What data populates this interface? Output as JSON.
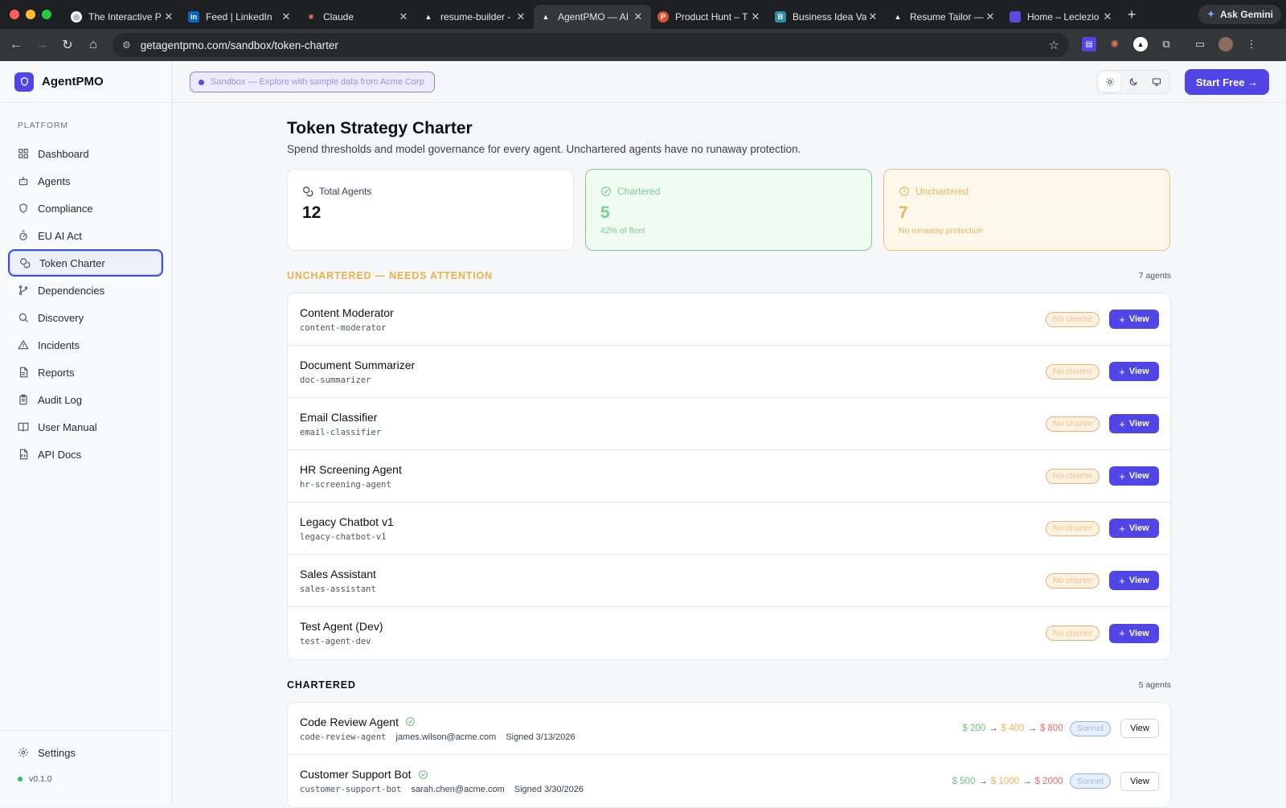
{
  "browser": {
    "tabs": [
      {
        "title": "The Interactive P",
        "favicon": "circle-logo",
        "color": "#ffffff",
        "active": false
      },
      {
        "title": "Feed | LinkedIn",
        "favicon": "linkedin",
        "color": "#0a66c2",
        "active": false
      },
      {
        "title": "Claude",
        "favicon": "claude-star",
        "color": "#d97757",
        "active": false
      },
      {
        "title": "resume-builder -",
        "favicon": "triangle",
        "color": "#ffffff",
        "active": false
      },
      {
        "title": "AgentPMO — AI",
        "favicon": "triangle",
        "color": "#ffffff",
        "active": true
      },
      {
        "title": "Product Hunt – T",
        "favicon": "producthunt",
        "color": "#da552f",
        "active": false
      },
      {
        "title": "Business Idea Va",
        "favicon": "b-square",
        "color": "#2f8fa6",
        "active": false
      },
      {
        "title": "Resume Tailor —",
        "favicon": "triangle",
        "color": "#ffffff",
        "active": false
      },
      {
        "title": "Home – Leclezio",
        "favicon": "purple-square",
        "color": "#5b4be0",
        "active": false
      }
    ],
    "url": "getagentpmo.com/sandbox/token-charter",
    "gemini_label": "Ask Gemini"
  },
  "app": {
    "brand": "AgentPMO",
    "sandbox_banner": "Sandbox — Explore with sample data from Acme Corp",
    "start_free": "Start Free →",
    "sidebar": {
      "section_label": "PLATFORM",
      "items": [
        {
          "label": "Dashboard",
          "icon": "grid-icon",
          "active": false
        },
        {
          "label": "Agents",
          "icon": "bot-icon",
          "active": false
        },
        {
          "label": "Compliance",
          "icon": "shield-icon",
          "active": false
        },
        {
          "label": "EU AI Act",
          "icon": "timer-icon",
          "active": false
        },
        {
          "label": "Token Charter",
          "icon": "coins-icon",
          "active": true
        },
        {
          "label": "Dependencies",
          "icon": "git-branch-icon",
          "active": false
        },
        {
          "label": "Discovery",
          "icon": "search-icon",
          "active": false
        },
        {
          "label": "Incidents",
          "icon": "alert-triangle-icon",
          "active": false
        },
        {
          "label": "Reports",
          "icon": "file-icon",
          "active": false
        },
        {
          "label": "Audit Log",
          "icon": "clipboard-icon",
          "active": false
        },
        {
          "label": "User Manual",
          "icon": "book-icon",
          "active": false
        },
        {
          "label": "API Docs",
          "icon": "file-code-icon",
          "active": false
        }
      ],
      "settings_label": "Settings",
      "version": "v0.1.0"
    },
    "page": {
      "title": "Token Strategy Charter",
      "subtitle": "Spend thresholds and model governance for every agent. Unchartered agents have no runaway protection.",
      "stats": {
        "total": {
          "label": "Total Agents",
          "value": "12"
        },
        "chartered": {
          "label": "Chartered",
          "value": "5",
          "sub": "42% of fleet"
        },
        "unchartered": {
          "label": "Unchartered",
          "value": "7",
          "sub": "No runaway protection"
        }
      },
      "unchartered_section": {
        "heading": "UNCHARTERED — NEEDS ATTENTION",
        "count": "7 agents",
        "badge": "No charter",
        "view": "View",
        "agents": [
          {
            "name": "Content Moderator",
            "id": "content-moderator"
          },
          {
            "name": "Document Summarizer",
            "id": "doc-summarizer"
          },
          {
            "name": "Email Classifier",
            "id": "email-classifier"
          },
          {
            "name": "HR Screening Agent",
            "id": "hr-screening-agent"
          },
          {
            "name": "Legacy Chatbot v1",
            "id": "legacy-chatbot-v1"
          },
          {
            "name": "Sales Assistant",
            "id": "sales-assistant"
          },
          {
            "name": "Test Agent (Dev)",
            "id": "test-agent-dev"
          }
        ]
      },
      "chartered_section": {
        "heading": "CHARTERED",
        "count": "5 agents",
        "view": "View",
        "agents": [
          {
            "name": "Code Review Agent",
            "id": "code-review-agent",
            "owner": "james.wilson@acme.com",
            "signed": "Signed 3/13/2026",
            "t1": "$ 200",
            "t2": "$ 400",
            "t3": "$ 800",
            "model": "Sonnet"
          },
          {
            "name": "Customer Support Bot",
            "id": "customer-support-bot",
            "owner": "sarah.chen@acme.com",
            "signed": "Signed 3/30/2026",
            "t1": "$ 500",
            "t2": "$ 1000",
            "t3": "$ 2000",
            "model": "Sonnet"
          }
        ]
      }
    }
  }
}
